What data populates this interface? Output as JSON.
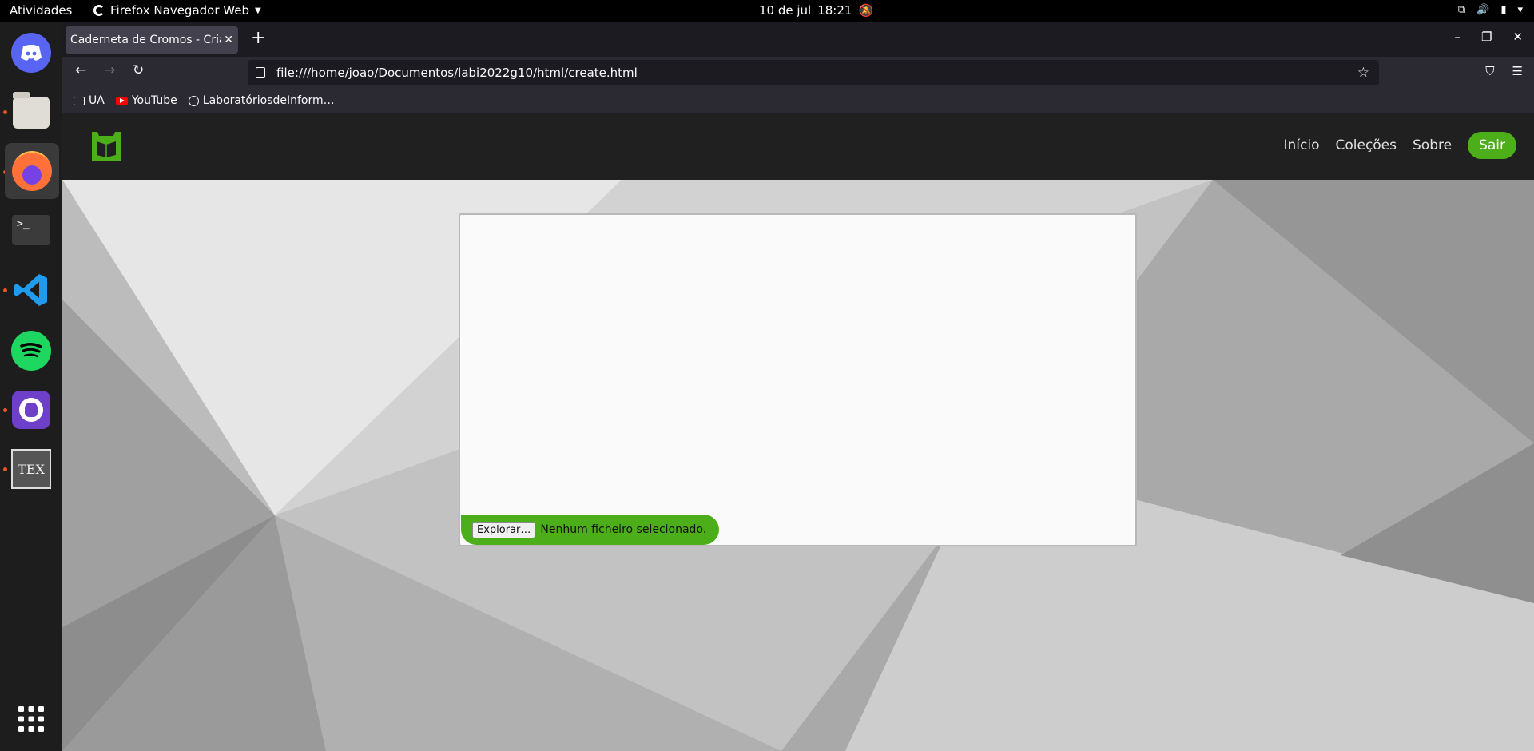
{
  "topbar": {
    "activities": "Atividades",
    "app_name": "Firefox Navegador Web",
    "date": "10 de jul",
    "time": "18:21"
  },
  "dock": {
    "items": [
      "discord",
      "files",
      "firefox",
      "terminal",
      "vscode",
      "spotify",
      "github-desktop",
      "texmaker",
      "app-grid"
    ]
  },
  "browser": {
    "tab_title": "Caderneta de Cromos - Criar",
    "url": "file:///home/joao/Documentos/labi2022g10/html/create.html",
    "bookmarks": [
      "UA",
      "YouTube",
      "LaboratóriosdeInform…"
    ]
  },
  "site": {
    "nav": {
      "inicio": "Início",
      "colecoes": "Coleções",
      "sobre": "Sobre",
      "sair": "Sair"
    },
    "file_input": {
      "button": "Explorar…",
      "status": "Nenhum ficheiro selecionado."
    }
  },
  "colors": {
    "accent": "#4caf1a",
    "navbar": "#202020",
    "firefox_toolbar": "#2b2a33"
  }
}
